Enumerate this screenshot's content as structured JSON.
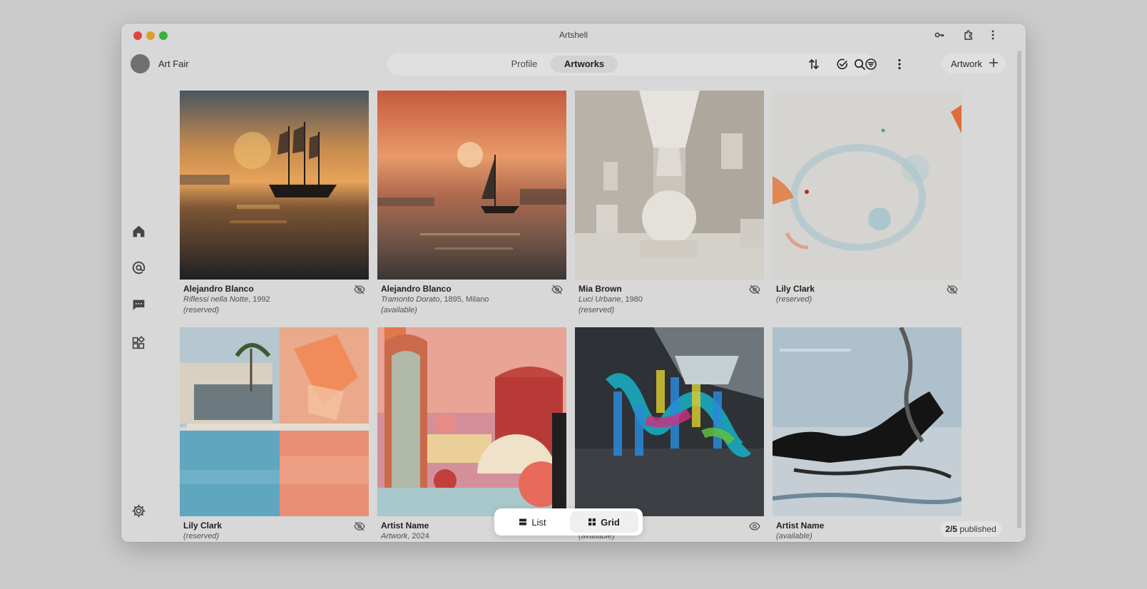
{
  "window": {
    "title": "Artshell"
  },
  "profile": {
    "name": "Art Fair"
  },
  "nav_tabs": [
    {
      "label": "Profile",
      "active": false
    },
    {
      "label": "Artworks",
      "active": true
    }
  ],
  "toolbar": {
    "artwork_button_label": "Artwork",
    "icons": [
      "sort-icon",
      "check-circle-icon",
      "filter-icon",
      "more-vertical-icon"
    ]
  },
  "sidebar": {
    "icons": [
      "home-icon",
      "at-sign-icon",
      "message-icon",
      "widgets-icon",
      "settings-icon"
    ]
  },
  "artworks": [
    {
      "artist": "Alejandro Blanco",
      "title": "Riflessi nella Notte",
      "details": ", 1992",
      "status": "(reserved)",
      "visibility": "hidden"
    },
    {
      "artist": "Alejandro Blanco",
      "title": "Tramonto Dorato",
      "details": ", 1895, Milano",
      "status": "(available)",
      "visibility": "hidden"
    },
    {
      "artist": "Mia Brown",
      "title": "Luci Urbane",
      "details": ", 1980",
      "status": "(reserved)",
      "visibility": "hidden"
    },
    {
      "artist": "Lily Clark",
      "title": "",
      "details": "",
      "status": "(reserved)",
      "visibility": "hidden"
    },
    {
      "artist": "Lily Clark",
      "title": "",
      "details": "",
      "status": "(reserved)",
      "visibility": "hidden"
    },
    {
      "artist": "Artist Name",
      "title": "Artwork",
      "details": ", 2024",
      "status": "",
      "visibility": "hidden"
    },
    {
      "artist": "",
      "title": "",
      "details": "",
      "status": "(available)",
      "visibility": "visible"
    },
    {
      "artist": "Artist Name",
      "title": "",
      "details": "",
      "status": "(available)",
      "visibility": "visible"
    }
  ],
  "view_toggle": {
    "list_label": "List",
    "grid_label": "Grid",
    "selected": "Grid"
  },
  "published": {
    "count": "2/5",
    "label": "published"
  }
}
